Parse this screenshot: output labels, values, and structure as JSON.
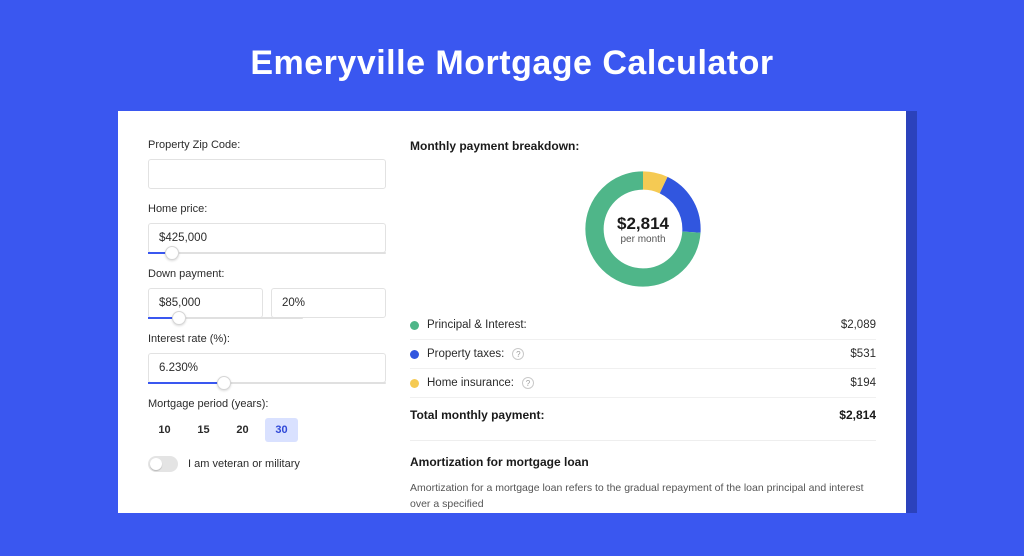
{
  "title": "Emeryville Mortgage Calculator",
  "form": {
    "zip_label": "Property Zip Code:",
    "zip_value": "",
    "home_price_label": "Home price:",
    "home_price_value": "$425,000",
    "home_price_slider_pct": 10,
    "down_payment_label": "Down payment:",
    "down_payment_value": "$85,000",
    "down_payment_pct": "20%",
    "down_payment_slider_pct": 20,
    "interest_rate_label": "Interest rate (%):",
    "interest_rate_value": "6.230%",
    "interest_rate_slider_pct": 32,
    "period_label": "Mortgage period (years):",
    "periods": [
      "10",
      "15",
      "20",
      "30"
    ],
    "period_active_index": 3,
    "veteran_label": "I am veteran or military"
  },
  "breakdown": {
    "title": "Monthly payment breakdown:",
    "amount": "$2,814",
    "per": "per month",
    "legend": [
      {
        "label": "Principal & Interest:",
        "value": "$2,089",
        "color": "#4fb689",
        "pct": 0.74,
        "info": false
      },
      {
        "label": "Property taxes:",
        "value": "$531",
        "color": "#3156df",
        "pct": 0.19,
        "info": true
      },
      {
        "label": "Home insurance:",
        "value": "$194",
        "color": "#f5ca53",
        "pct": 0.07,
        "info": true
      }
    ],
    "total_label": "Total monthly payment:",
    "total_value": "$2,814"
  },
  "amort": {
    "title": "Amortization for mortgage loan",
    "text": "Amortization for a mortgage loan refers to the gradual repayment of the loan principal and interest over a specified"
  },
  "chart_data": {
    "type": "pie",
    "title": "Monthly payment breakdown",
    "categories": [
      "Principal & Interest",
      "Property taxes",
      "Home insurance"
    ],
    "values": [
      2089,
      531,
      194
    ],
    "colors": [
      "#4fb689",
      "#3156df",
      "#f5ca53"
    ],
    "total": 2814,
    "unit": "USD/month"
  }
}
